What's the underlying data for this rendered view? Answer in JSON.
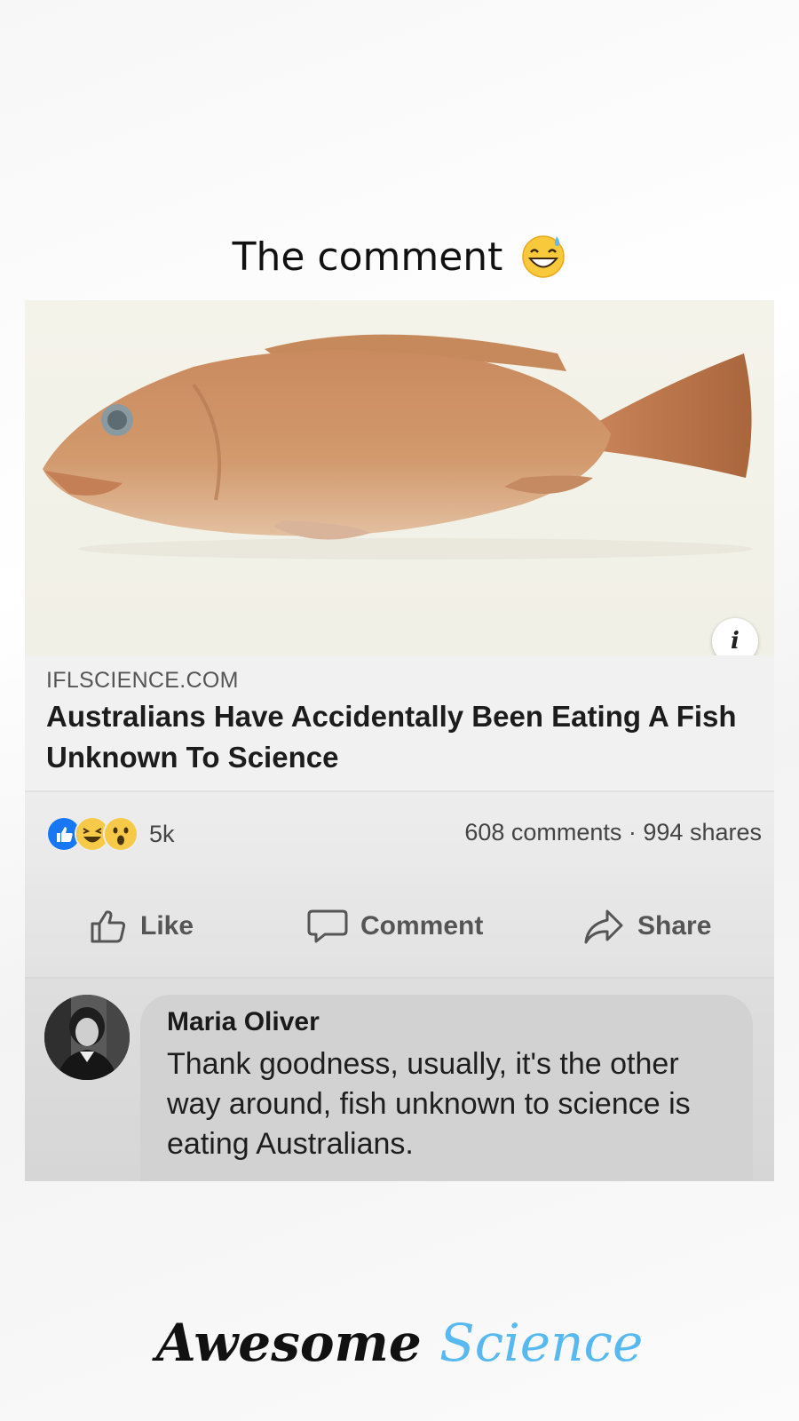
{
  "caption": {
    "text": "The comment",
    "emoji_icon": "grinning-face-with-sweat-icon"
  },
  "post": {
    "image_icon": "grouper-fish-photo",
    "info_icon": "i",
    "domain": "IFLSCIENCE.COM",
    "headline": "Australians Have Accidentally Been Eating A Fish Unknown To Science",
    "reactions": {
      "icons": [
        "like-reaction-icon",
        "haha-reaction-icon",
        "wow-reaction-icon"
      ],
      "count": "5k"
    },
    "counts": "608 comments · 994 shares",
    "actions": {
      "like": "Like",
      "comment": "Comment",
      "share": "Share"
    }
  },
  "top_comment": {
    "author": "Maria Oliver",
    "text": "Thank goodness, usually, it's the other way around, fish unknown to science is eating Australians."
  },
  "brand": {
    "word1": "Awesome",
    "word2": "Science"
  },
  "colors": {
    "brand_accent": "#58b9f0",
    "like_blue": "#1877f2",
    "haha_yellow": "#f7c948"
  }
}
